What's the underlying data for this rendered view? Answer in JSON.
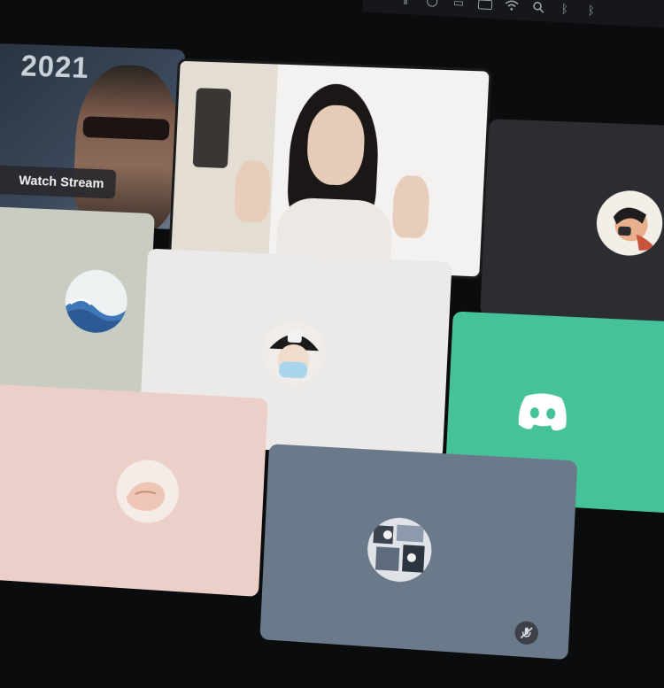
{
  "stream_tile": {
    "year_text": "2021",
    "watch_button_label": "Watch Stream"
  },
  "tiles": [
    {
      "id": "stream",
      "background": "#3b4a5c"
    },
    {
      "id": "webcam",
      "background": "#f4f2f0"
    },
    {
      "id": "dark-avatar",
      "background": "#2b2d31",
      "avatar_icon": "cartoon-avatar-icon"
    },
    {
      "id": "sage-avatar",
      "background": "#c8ccc1",
      "avatar_icon": "wave-avatar-icon"
    },
    {
      "id": "white-avatar",
      "background": "#eceae8",
      "avatar_icon": "masked-cap-avatar-icon"
    },
    {
      "id": "green-default",
      "background": "#46c29a",
      "avatar_icon": "discord-logo-icon"
    },
    {
      "id": "pink-avatar",
      "background": "#ebcfc8",
      "avatar_icon": "hand-avatar-icon"
    },
    {
      "id": "slate-avatar",
      "background": "#6a7a8b",
      "avatar_icon": "collage-avatar-icon",
      "status_icon": "muted-mic-icon"
    }
  ],
  "system_bar": {
    "icons": [
      "pause-icon",
      "circle-icon",
      "flag-icon",
      "battery-icon",
      "wifi-icon",
      "search-icon",
      "bluetooth-icon",
      "bluetooth-icon"
    ]
  }
}
